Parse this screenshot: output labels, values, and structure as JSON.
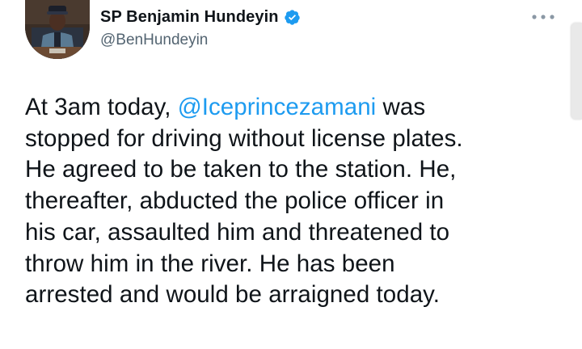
{
  "tweet": {
    "author": {
      "display_name": "SP Benjamin Hundeyin",
      "handle": "@BenHundeyin",
      "avatar_icon": "profile-photo",
      "verified_icon": "verified-badge-icon"
    },
    "more_icon": "more-options-icon",
    "body_lines": [
      {
        "before": "At 3am today, ",
        "mention": "@Iceprincezamani",
        "after": " was"
      },
      {
        "text": "stopped for driving without license plates."
      },
      {
        "text": "He agreed to be taken to the station. He,"
      },
      {
        "text": "thereafter, abducted the police officer in"
      },
      {
        "text": "his car, assaulted him and threatened to"
      },
      {
        "text": "throw him in the river. He has been"
      },
      {
        "text": "arrested and would be arraigned today."
      }
    ]
  },
  "colors": {
    "mention": "#1d9bf0",
    "verified": "#1d9bf0",
    "handle": "#536471",
    "text": "#0f1419"
  }
}
